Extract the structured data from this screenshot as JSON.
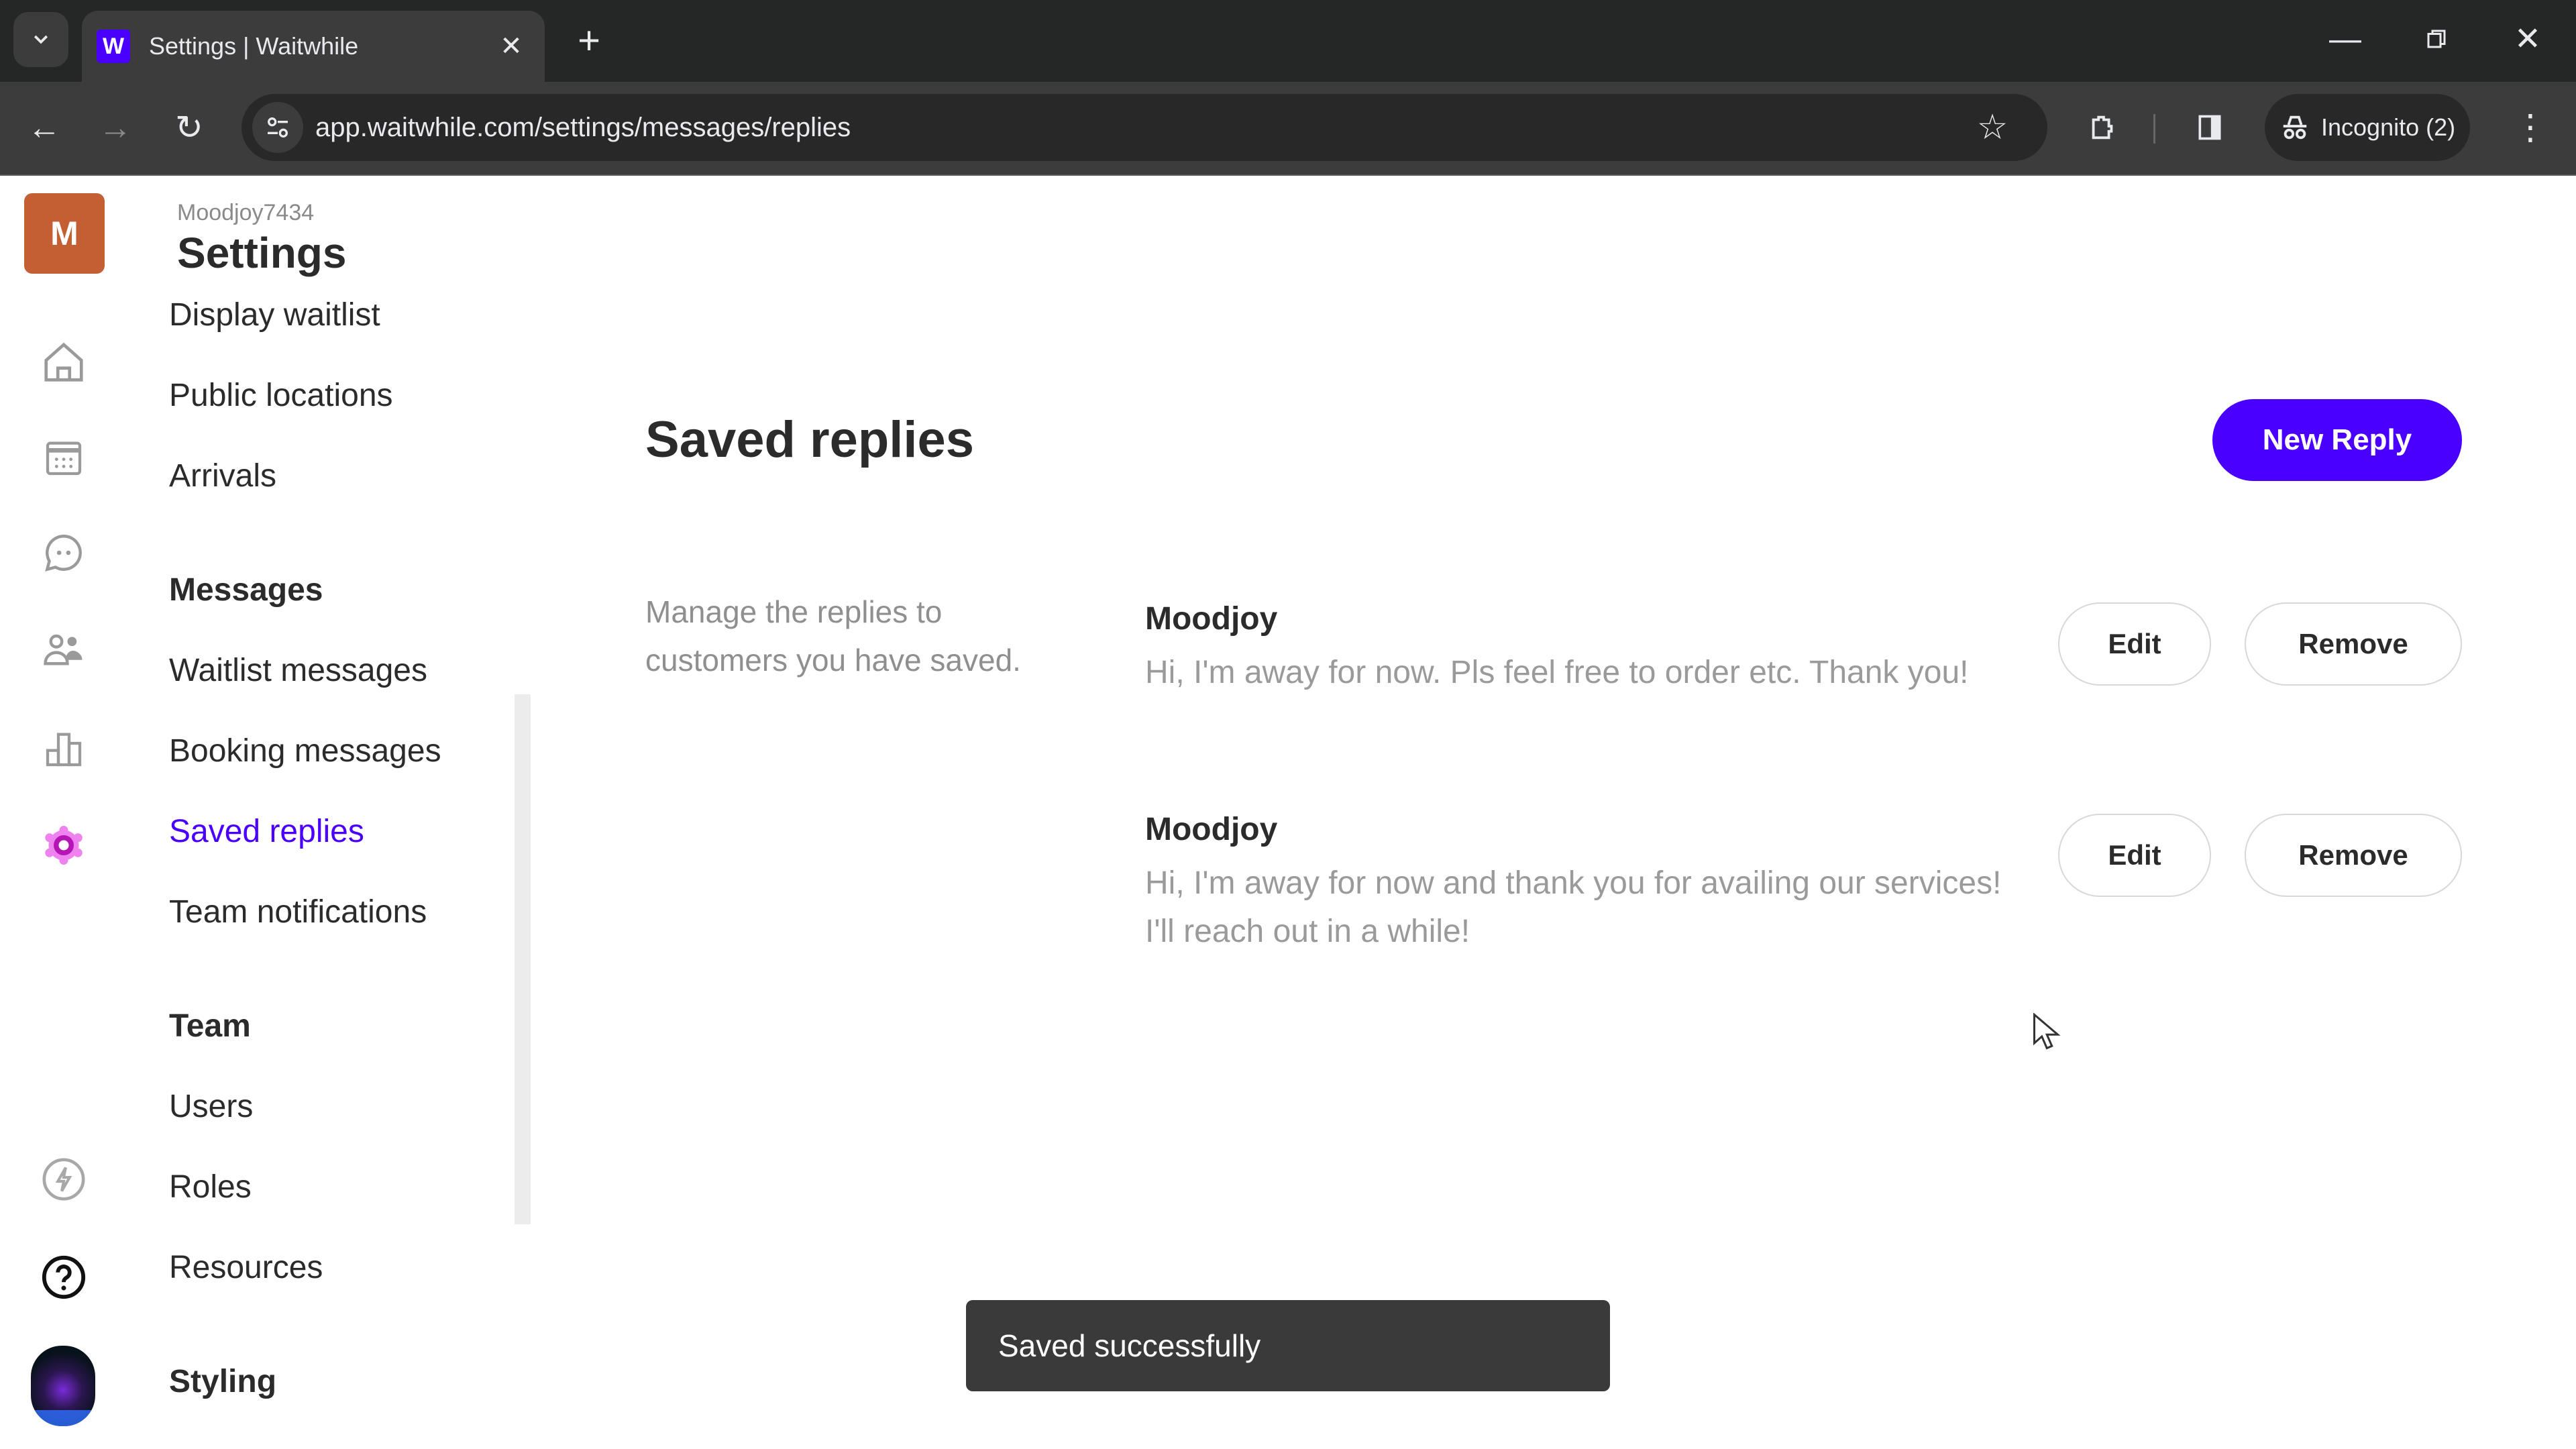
{
  "browser": {
    "tab_title": "Settings | Waitwhile",
    "favicon_letter": "W",
    "url": "app.waitwhile.com/settings/messages/replies",
    "incognito_label": "Incognito (2)"
  },
  "rail": {
    "org_initial": "M",
    "org_avatar_color": "#c45f33",
    "icons": [
      "home-icon",
      "calendar-icon",
      "chat-icon",
      "customers-icon",
      "analytics-icon",
      "settings-icon",
      "bolt-icon",
      "help-icon"
    ],
    "active_icon": "settings-icon"
  },
  "settings_nav": {
    "org_name": "Moodjoy7434",
    "title": "Settings",
    "items": [
      {
        "label": "Display waitlist",
        "type": "item"
      },
      {
        "label": "Public locations",
        "type": "item"
      },
      {
        "label": "Arrivals",
        "type": "item"
      },
      {
        "label": "Messages",
        "type": "section"
      },
      {
        "label": "Waitlist messages",
        "type": "item"
      },
      {
        "label": "Booking messages",
        "type": "item"
      },
      {
        "label": "Saved replies",
        "type": "item",
        "active": true
      },
      {
        "label": "Team notifications",
        "type": "item"
      },
      {
        "label": "Team",
        "type": "section"
      },
      {
        "label": "Users",
        "type": "item"
      },
      {
        "label": "Roles",
        "type": "item"
      },
      {
        "label": "Resources",
        "type": "item"
      },
      {
        "label": "Styling",
        "type": "section"
      }
    ]
  },
  "main": {
    "title": "Saved replies",
    "new_reply_label": "New Reply",
    "description": "Manage the replies to customers you have saved.",
    "replies": [
      {
        "name": "Moodjoy",
        "text": "Hi, I'm away for now. Pls feel free to order etc. Thank you!",
        "edit_label": "Edit",
        "remove_label": "Remove"
      },
      {
        "name": "Moodjoy",
        "text": "Hi, I'm away for now and thank you for availing our services! I'll reach out in a while!",
        "edit_label": "Edit",
        "remove_label": "Remove"
      }
    ]
  },
  "toast": {
    "message": "Saved successfully"
  },
  "colors": {
    "accent": "#4a00ff",
    "active_nav_icon": "#d946ef"
  }
}
